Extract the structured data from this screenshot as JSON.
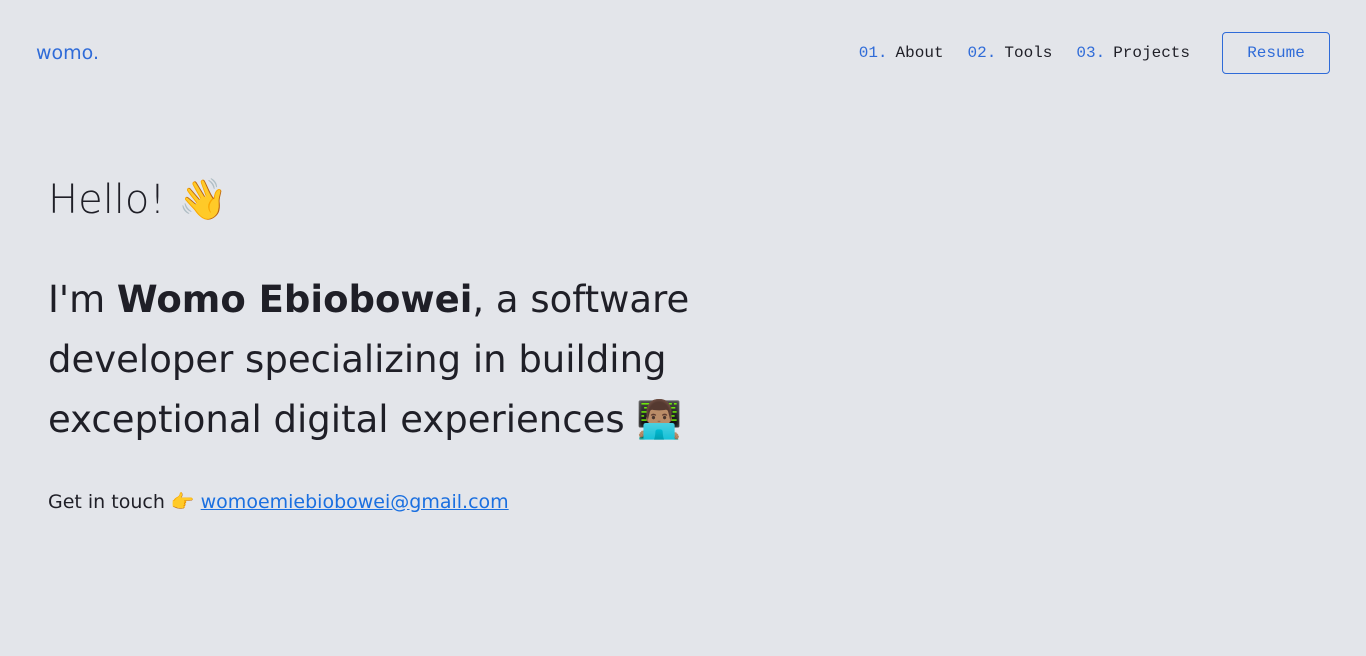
{
  "header": {
    "logo": "womo.",
    "nav": [
      {
        "num": "01.",
        "label": "About"
      },
      {
        "num": "02.",
        "label": "Tools"
      },
      {
        "num": "03.",
        "label": "Projects"
      }
    ],
    "resume_label": "Resume"
  },
  "hero": {
    "greeting": "Hello!",
    "greeting_emoji": "👋",
    "intro_prefix": "I'm ",
    "name": "Womo Ebiobowei",
    "intro_suffix": ", a software developer specializing in building exceptional digital experiences",
    "intro_emoji": "👨🏽‍💻",
    "contact_prefix": "Get in touch",
    "contact_emoji": "👉",
    "email": "womoemiebiobowei@gmail.com"
  },
  "colors": {
    "background": "#e3e5ea",
    "accent": "#2f6bd8",
    "link": "#1a6fe0",
    "text": "#1f1f27"
  }
}
